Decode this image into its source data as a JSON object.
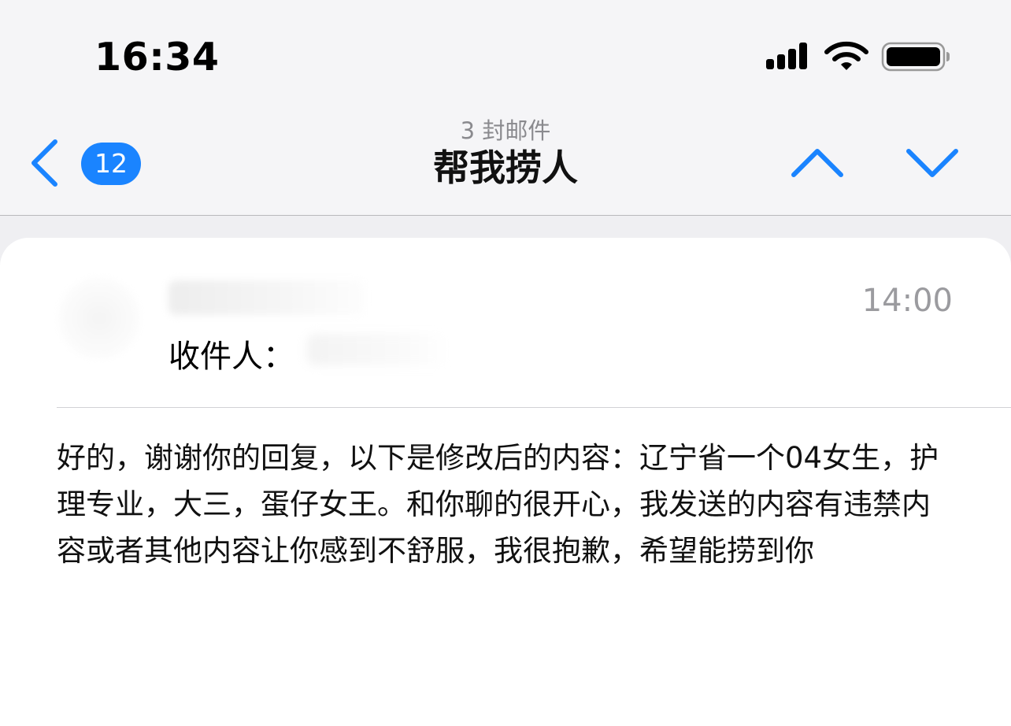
{
  "status_bar": {
    "time": "16:34",
    "icons": [
      "cellular-signal-icon",
      "wifi-icon",
      "battery-icon"
    ]
  },
  "nav": {
    "back_icon": "chevron-left-icon",
    "unread_count": "12",
    "subtitle": "3 封邮件",
    "title": "帮我捞人",
    "prev_icon": "chevron-up-icon",
    "next_icon": "chevron-down-icon"
  },
  "message": {
    "sender": "",
    "time": "14:00",
    "recipient_label": "收件人：",
    "recipient": "",
    "body": "好的，谢谢你的回复，以下是修改后的内容：辽宁省一个04女生，护理专业，大三，蛋仔女王。和你聊的很开心，我发送的内容有违禁内容或者其他内容让你感到不舒服，我很抱歉，希望能捞到你"
  },
  "colors": {
    "accent": "#1a84ff",
    "secondary_text": "#8a8a8e",
    "background": "#efeff2"
  }
}
